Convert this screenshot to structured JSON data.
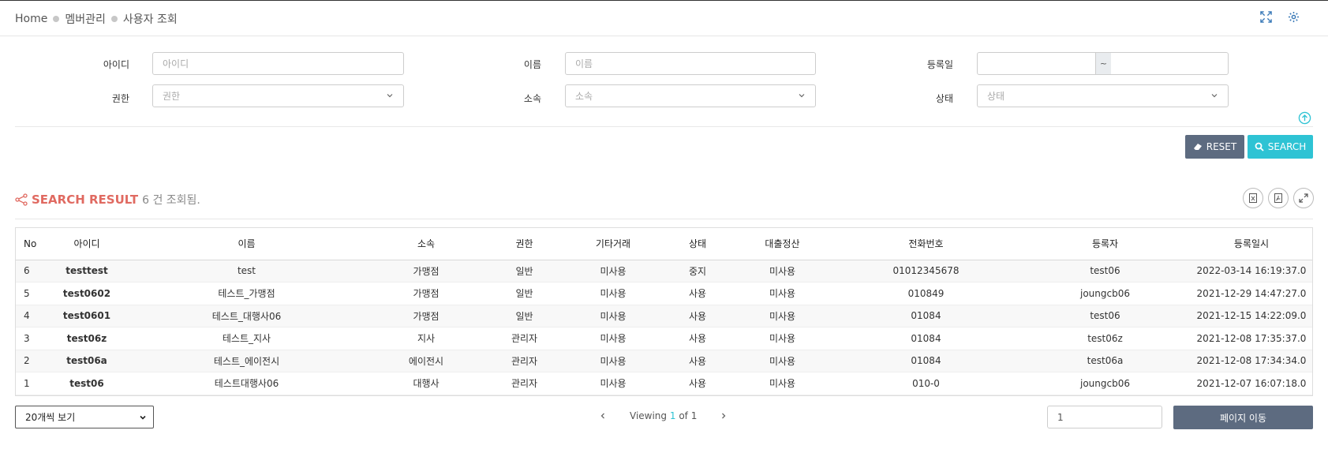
{
  "breadcrumb": {
    "home": "Home",
    "section": "멤버관리",
    "page": "사용자 조회"
  },
  "icons": {
    "fullscreen": "fullscreen-icon",
    "settings": "gear-icon",
    "share": "share-icon",
    "excel": "excel-icon",
    "pdf": "pdf-icon",
    "expand": "expand-icon",
    "collapse": "arrow-up-circle-icon",
    "eraser": "eraser-icon",
    "search": "search-icon"
  },
  "filters": {
    "id": {
      "label": "아이디",
      "placeholder": "아이디"
    },
    "name": {
      "label": "이름",
      "placeholder": "이름"
    },
    "regdate": {
      "label": "등록일",
      "separator": "~"
    },
    "role": {
      "label": "권한",
      "value": "권한"
    },
    "affiliation": {
      "label": "소속",
      "value": "소속"
    },
    "status": {
      "label": "상태",
      "value": "상태"
    }
  },
  "buttons": {
    "reset": "RESET",
    "search": "SEARCH"
  },
  "result": {
    "title": "SEARCH RESULT",
    "count": "6 건 조회됨."
  },
  "table": {
    "headers": [
      "No",
      "아이디",
      "이름",
      "소속",
      "권한",
      "기타거래",
      "상태",
      "대출정산",
      "전화번호",
      "등록자",
      "등록일시"
    ],
    "rows": [
      [
        "6",
        "testtest",
        "test",
        "가맹점",
        "일반",
        "미사용",
        "중지",
        "미사용",
        "01012345678",
        "test06",
        "2022-03-14 16:19:37.0"
      ],
      [
        "5",
        "test0602",
        "테스트_가맹점",
        "가맹점",
        "일반",
        "미사용",
        "사용",
        "미사용",
        "010849",
        "joungcb06",
        "2021-12-29 14:47:27.0"
      ],
      [
        "4",
        "test0601",
        "테스트_대행사06",
        "가맹점",
        "일반",
        "미사용",
        "사용",
        "미사용",
        "01084",
        "test06",
        "2021-12-15 14:22:09.0"
      ],
      [
        "3",
        "test06z",
        "테스트_지사",
        "지사",
        "관리자",
        "미사용",
        "사용",
        "미사용",
        "01084",
        "test06z",
        "2021-12-08 17:35:37.0"
      ],
      [
        "2",
        "test06a",
        "테스트_에이전시",
        "에이전시",
        "관리자",
        "미사용",
        "사용",
        "미사용",
        "01084",
        "test06a",
        "2021-12-08 17:34:34.0"
      ],
      [
        "1",
        "test06",
        "테스트대행사06",
        "대행사",
        "관리자",
        "미사용",
        "사용",
        "미사용",
        "010-0",
        "joungcb06",
        "2021-12-07 16:07:18.0"
      ]
    ]
  },
  "footer": {
    "page_size": "20개씩 보기",
    "viewing_prefix": "Viewing",
    "current_page": "1",
    "viewing_suffix": "of 1",
    "page_input": "1",
    "go_label": "페이지 이동"
  },
  "colors": {
    "accent": "#2ec3d4",
    "reset": "#5d6b80",
    "result_title": "#e06a61"
  }
}
